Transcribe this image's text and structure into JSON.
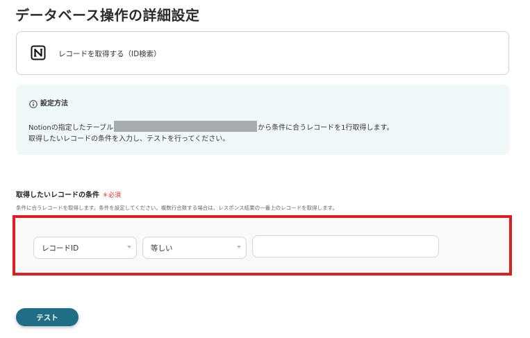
{
  "page": {
    "title": "データベース操作の詳細設定"
  },
  "action": {
    "app_icon": "notion-icon",
    "label": "レコードを取得する（ID検索）"
  },
  "info": {
    "icon": "info-icon",
    "heading": "設定方法",
    "line1_prefix": "Notionの指定したテーブル",
    "line1_suffix": "から条件に合うレコードを1行取得します。",
    "line2": "取得したいレコードの条件を入力し、テストを行ってください。",
    "background_color": "#f1f8f8"
  },
  "condition_field": {
    "label": "取得したいレコードの条件",
    "required_mark": "＊必須",
    "help": "条件に合うレコードを取得します。条件を設定してください。複数行合致する場合は、レスポンス結果の一番上のレコードを取得します。",
    "highlight_color": "#dd1f24",
    "field_select": {
      "value": "レコードID"
    },
    "operator_select": {
      "value": "等しい"
    },
    "value_input": {
      "value": ""
    }
  },
  "test_button": {
    "label": "テスト",
    "color": "#1f6e85"
  }
}
